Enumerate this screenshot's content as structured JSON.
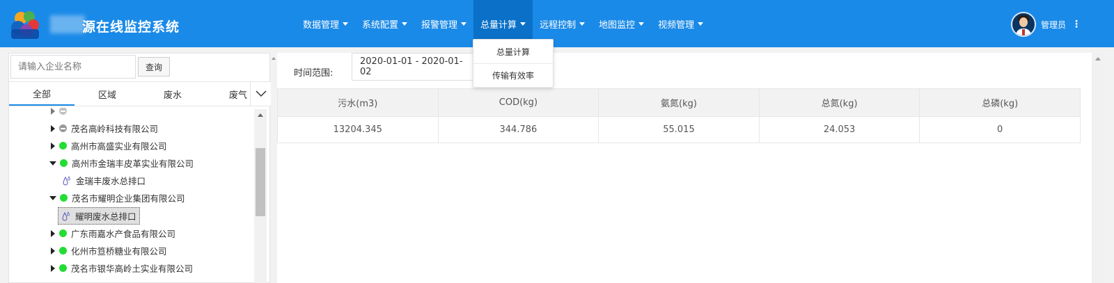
{
  "header": {
    "title": "源在线监控系统",
    "nav": [
      {
        "label": "数据管理"
      },
      {
        "label": "系统配置"
      },
      {
        "label": "报警管理"
      },
      {
        "label": "总量计算"
      },
      {
        "label": "远程控制"
      },
      {
        "label": "地图监控"
      },
      {
        "label": "视频管理"
      }
    ],
    "active_nav": "总量计算",
    "user_label": "管理员",
    "accent_color": "#1a8ae8"
  },
  "dropdown": {
    "items": [
      {
        "label": "总量计算"
      },
      {
        "label": "传输有效率"
      }
    ]
  },
  "left": {
    "search_placeholder": "请输入企业名称",
    "search_button": "查询",
    "tabs": [
      {
        "label": "全部"
      },
      {
        "label": "区域"
      },
      {
        "label": "废水"
      },
      {
        "label": "废气"
      }
    ],
    "tree": [
      {
        "label": "茂名高岭科技有限公司",
        "status": "offline",
        "expanded": false
      },
      {
        "label": "高州市高盛实业有限公司",
        "status": "online",
        "expanded": false
      },
      {
        "label": "高州市金瑞丰皮革实业有限公司",
        "status": "online",
        "expanded": true
      },
      {
        "label": "金瑞丰废水总排口",
        "leaf": true
      },
      {
        "label": "茂名市耀明企业集团有限公司",
        "status": "online",
        "expanded": true
      },
      {
        "label": "耀明废水总排口",
        "leaf": true,
        "selected": true
      },
      {
        "label": "广东雨嘉水产食品有限公司",
        "status": "online",
        "expanded": false
      },
      {
        "label": "化州市笪桥糖业有限公司",
        "status": "online",
        "expanded": false
      },
      {
        "label": "茂名市银华高岭土实业有限公司",
        "status": "online",
        "expanded": false
      }
    ]
  },
  "right": {
    "filter_label": "时间范围:",
    "date_range": "2020-01-01 - 2020-01-02",
    "table": {
      "headers": [
        "污水(m3)",
        "COD(kg)",
        "氨氮(kg)",
        "总氮(kg)",
        "总磷(kg)"
      ],
      "rows": [
        [
          "13204.345",
          "344.786",
          "55.015",
          "24.053",
          "0"
        ]
      ]
    }
  }
}
